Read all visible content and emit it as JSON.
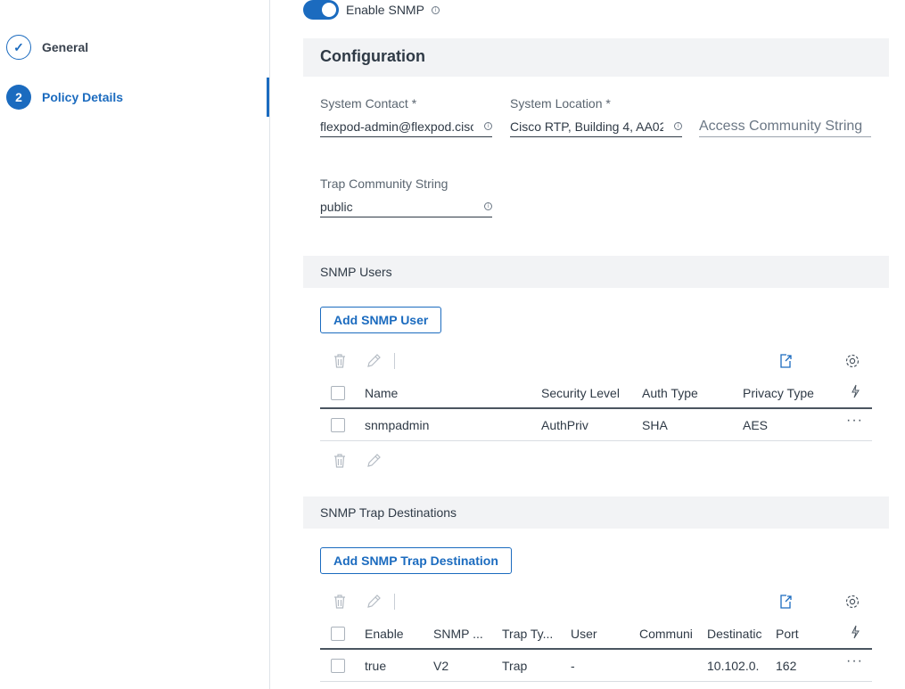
{
  "sidebar": {
    "steps": [
      {
        "marker": "✓",
        "label": "General",
        "state": "done"
      },
      {
        "marker": "2",
        "label": "Policy Details",
        "state": "active"
      }
    ]
  },
  "snmp": {
    "enable_label": "Enable SNMP",
    "enabled": true
  },
  "configuration": {
    "title": "Configuration",
    "system_contact": {
      "label": "System Contact *",
      "value": "flexpod-admin@flexpod.cisco.com"
    },
    "system_location": {
      "label": "System Location *",
      "value": "Cisco RTP, Building 4, AA02"
    },
    "access_community": {
      "placeholder": "Access Community String"
    },
    "trap_community": {
      "label": "Trap Community String",
      "value": "public"
    }
  },
  "snmp_users": {
    "title": "SNMP Users",
    "add_button": "Add SNMP User",
    "columns": [
      "Name",
      "Security Level",
      "Auth Type",
      "Privacy Type"
    ],
    "rows": [
      {
        "name": "snmpadmin",
        "security_level": "AuthPriv",
        "auth_type": "SHA",
        "privacy_type": "AES"
      }
    ]
  },
  "trap_destinations": {
    "title": "SNMP Trap Destinations",
    "add_button": "Add SNMP Trap Destination",
    "columns": [
      "Enable",
      "SNMP ...",
      "Trap Ty...",
      "User",
      "Communi",
      "Destinatic",
      "Port"
    ],
    "rows": [
      {
        "enable": "true",
        "snmp_version": "V2",
        "trap_type": "Trap",
        "user": "-",
        "community": "",
        "destination": "10.102.0.",
        "port": "162"
      }
    ]
  },
  "colors": {
    "accent": "#1b6bbf",
    "section_bg": "#f2f3f5"
  },
  "icons": [
    "check-icon",
    "info-icon",
    "trash-icon",
    "pencil-icon",
    "export-icon",
    "gear-icon",
    "bolt-icon",
    "more-icon"
  ]
}
